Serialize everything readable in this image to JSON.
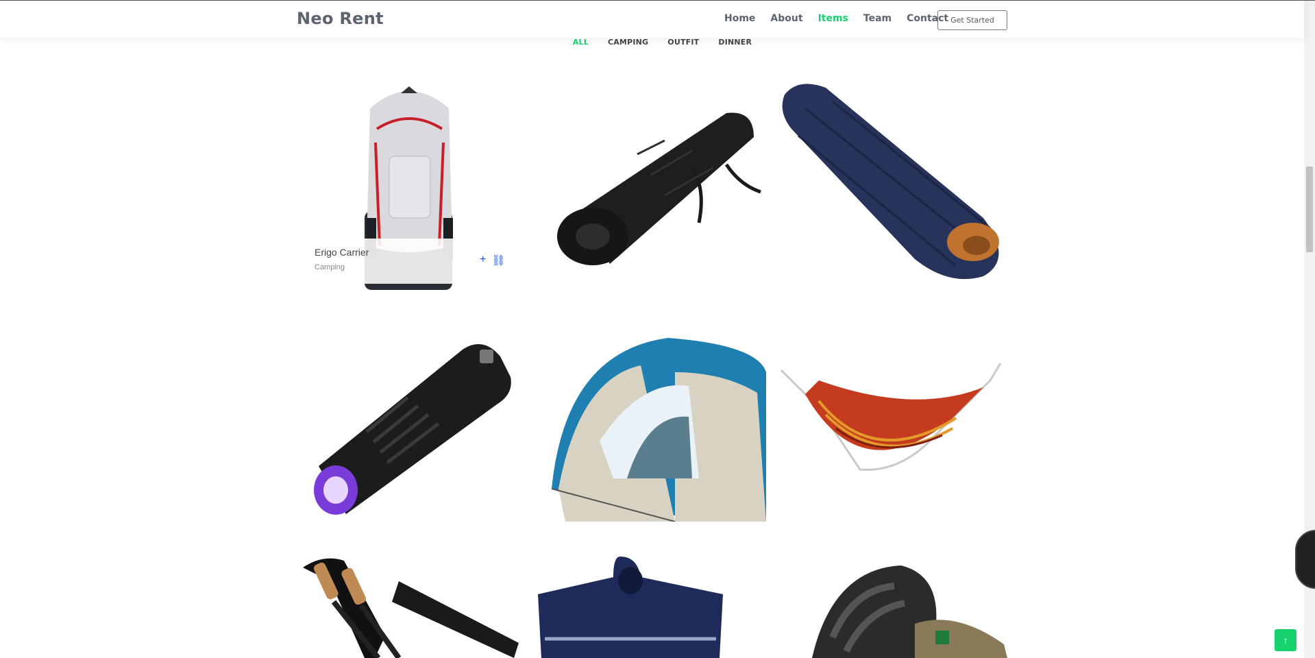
{
  "brand": "Neo Rent",
  "nav": [
    {
      "label": "Home",
      "active": false
    },
    {
      "label": "About",
      "active": false
    },
    {
      "label": "Items",
      "active": true
    },
    {
      "label": "Team",
      "active": false
    },
    {
      "label": "Contact",
      "active": false
    }
  ],
  "cta_label": "Get Started",
  "filters": [
    {
      "label": "ALL",
      "active": true
    },
    {
      "label": "CAMPING",
      "active": false
    },
    {
      "label": "OUTFIT",
      "active": false
    },
    {
      "label": "DINNER",
      "active": false
    }
  ],
  "hover_item": {
    "title": "Erigo Carrier",
    "category": "Camping"
  },
  "icons": {
    "add": "plus-icon",
    "link": "link-icon",
    "back_to_top": "arrow-up-icon"
  },
  "colors": {
    "accent": "#18d26e",
    "link_icon": "#1a56db"
  }
}
